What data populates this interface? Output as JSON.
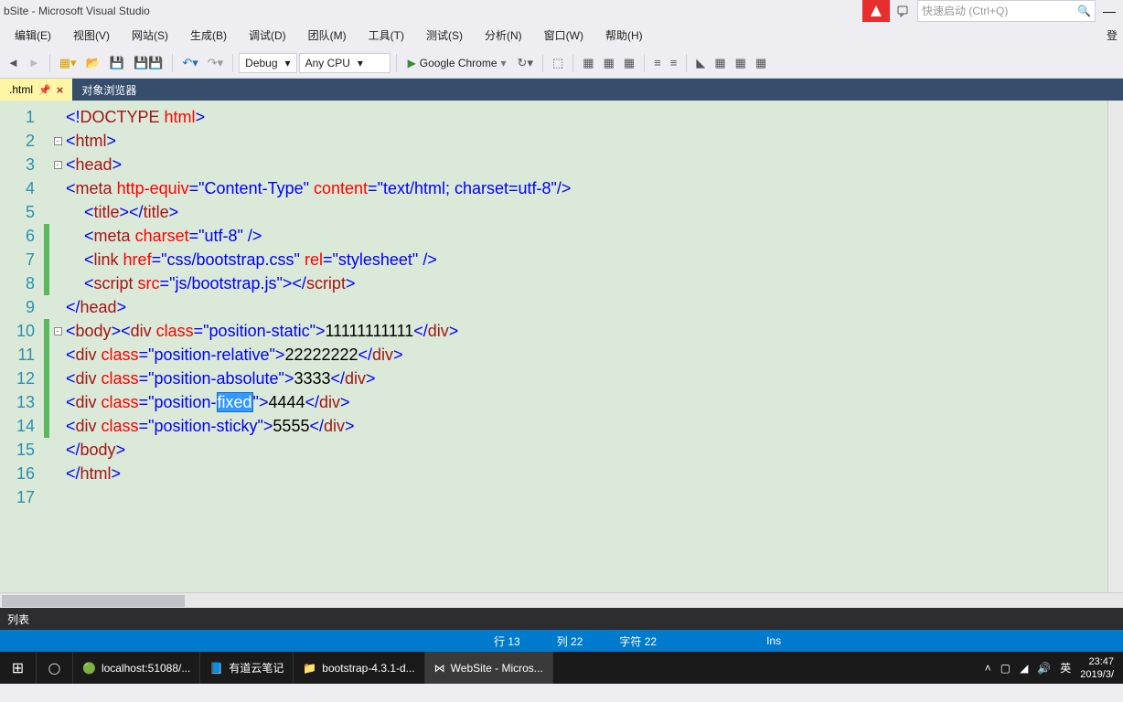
{
  "title": "bSite - Microsoft Visual Studio",
  "search_placeholder": "快速启动 (Ctrl+Q)",
  "right_label": "登",
  "menu": [
    "编辑(E)",
    "视图(V)",
    "网站(S)",
    "生成(B)",
    "调试(D)",
    "团队(M)",
    "工具(T)",
    "测试(S)",
    "分析(N)",
    "窗口(W)",
    "帮助(H)"
  ],
  "toolbar": {
    "config": "Debug",
    "platform": "Any CPU",
    "run_target": "Google Chrome"
  },
  "tabs": [
    {
      "label": ".html",
      "active": true
    },
    {
      "label": "对象浏览器",
      "active": false
    }
  ],
  "code_lines": [
    {
      "n": 1,
      "fold": "",
      "mark": "",
      "tokens": [
        {
          "t": "<!",
          "c": "c-blue"
        },
        {
          "t": "DOCTYPE",
          "c": "c-brown"
        },
        {
          "t": " ",
          "c": "c-text"
        },
        {
          "t": "html",
          "c": "c-red"
        },
        {
          "t": ">",
          "c": "c-blue"
        }
      ]
    },
    {
      "n": 2,
      "fold": "-",
      "mark": "",
      "tokens": [
        {
          "t": "<",
          "c": "c-blue"
        },
        {
          "t": "html",
          "c": "c-brown"
        },
        {
          "t": ">",
          "c": "c-blue"
        }
      ]
    },
    {
      "n": 3,
      "fold": "-",
      "mark": "",
      "tokens": [
        {
          "t": "<",
          "c": "c-blue"
        },
        {
          "t": "head",
          "c": "c-brown"
        },
        {
          "t": ">",
          "c": "c-blue"
        }
      ]
    },
    {
      "n": 4,
      "fold": "",
      "mark": "",
      "tokens": [
        {
          "t": "<",
          "c": "c-blue"
        },
        {
          "t": "meta",
          "c": "c-brown"
        },
        {
          "t": " ",
          "c": ""
        },
        {
          "t": "http-equiv",
          "c": "c-red"
        },
        {
          "t": "=",
          "c": "c-blue"
        },
        {
          "t": "\"Content-Type\"",
          "c": "c-str"
        },
        {
          "t": " ",
          "c": ""
        },
        {
          "t": "content",
          "c": "c-red"
        },
        {
          "t": "=",
          "c": "c-blue"
        },
        {
          "t": "\"text/html; charset=utf-8\"",
          "c": "c-str"
        },
        {
          "t": "/>",
          "c": "c-blue"
        }
      ]
    },
    {
      "n": 5,
      "fold": "",
      "mark": "",
      "tokens": [
        {
          "t": "    <",
          "c": "c-blue"
        },
        {
          "t": "title",
          "c": "c-brown"
        },
        {
          "t": "></",
          "c": "c-blue"
        },
        {
          "t": "title",
          "c": "c-brown"
        },
        {
          "t": ">",
          "c": "c-blue"
        }
      ]
    },
    {
      "n": 6,
      "fold": "",
      "mark": "green",
      "tokens": [
        {
          "t": "    <",
          "c": "c-blue"
        },
        {
          "t": "meta",
          "c": "c-brown"
        },
        {
          "t": " ",
          "c": ""
        },
        {
          "t": "charset",
          "c": "c-red"
        },
        {
          "t": "=",
          "c": "c-blue"
        },
        {
          "t": "\"utf-8\"",
          "c": "c-str"
        },
        {
          "t": " />",
          "c": "c-blue"
        }
      ]
    },
    {
      "n": 7,
      "fold": "",
      "mark": "green",
      "tokens": [
        {
          "t": "    <",
          "c": "c-blue"
        },
        {
          "t": "link",
          "c": "c-brown"
        },
        {
          "t": " ",
          "c": ""
        },
        {
          "t": "href",
          "c": "c-red"
        },
        {
          "t": "=",
          "c": "c-blue"
        },
        {
          "t": "\"css/bootstrap.css\"",
          "c": "c-str"
        },
        {
          "t": " ",
          "c": ""
        },
        {
          "t": "rel",
          "c": "c-red"
        },
        {
          "t": "=",
          "c": "c-blue"
        },
        {
          "t": "\"stylesheet\"",
          "c": "c-str"
        },
        {
          "t": " />",
          "c": "c-blue"
        }
      ]
    },
    {
      "n": 8,
      "fold": "",
      "mark": "green",
      "tokens": [
        {
          "t": "    <",
          "c": "c-blue"
        },
        {
          "t": "script",
          "c": "c-brown"
        },
        {
          "t": " ",
          "c": ""
        },
        {
          "t": "src",
          "c": "c-red"
        },
        {
          "t": "=",
          "c": "c-blue"
        },
        {
          "t": "\"js/bootstrap.js\"",
          "c": "c-str"
        },
        {
          "t": "></",
          "c": "c-blue"
        },
        {
          "t": "script",
          "c": "c-brown"
        },
        {
          "t": ">",
          "c": "c-blue"
        }
      ]
    },
    {
      "n": 9,
      "fold": "",
      "mark": "",
      "tokens": [
        {
          "t": "</",
          "c": "c-blue"
        },
        {
          "t": "head",
          "c": "c-brown"
        },
        {
          "t": ">",
          "c": "c-blue"
        }
      ]
    },
    {
      "n": 10,
      "fold": "-",
      "mark": "green",
      "tokens": [
        {
          "t": "<",
          "c": "c-blue"
        },
        {
          "t": "body",
          "c": "c-brown"
        },
        {
          "t": "><",
          "c": "c-blue"
        },
        {
          "t": "div",
          "c": "c-brown"
        },
        {
          "t": " ",
          "c": ""
        },
        {
          "t": "class",
          "c": "c-red"
        },
        {
          "t": "=",
          "c": "c-blue"
        },
        {
          "t": "\"position-static\"",
          "c": "c-str"
        },
        {
          "t": ">",
          "c": "c-blue"
        },
        {
          "t": "11111111111",
          "c": "c-text"
        },
        {
          "t": "</",
          "c": "c-blue"
        },
        {
          "t": "div",
          "c": "c-brown"
        },
        {
          "t": ">",
          "c": "c-blue"
        }
      ]
    },
    {
      "n": 11,
      "fold": "",
      "mark": "green",
      "tokens": [
        {
          "t": "<",
          "c": "c-blue"
        },
        {
          "t": "div",
          "c": "c-brown"
        },
        {
          "t": " ",
          "c": ""
        },
        {
          "t": "class",
          "c": "c-red"
        },
        {
          "t": "=",
          "c": "c-blue"
        },
        {
          "t": "\"position-relative\"",
          "c": "c-str"
        },
        {
          "t": ">",
          "c": "c-blue"
        },
        {
          "t": "22222222",
          "c": "c-text"
        },
        {
          "t": "</",
          "c": "c-blue"
        },
        {
          "t": "div",
          "c": "c-brown"
        },
        {
          "t": ">",
          "c": "c-blue"
        }
      ]
    },
    {
      "n": 12,
      "fold": "",
      "mark": "green",
      "tokens": [
        {
          "t": "<",
          "c": "c-blue"
        },
        {
          "t": "div",
          "c": "c-brown"
        },
        {
          "t": " ",
          "c": ""
        },
        {
          "t": "class",
          "c": "c-red"
        },
        {
          "t": "=",
          "c": "c-blue"
        },
        {
          "t": "\"position-absolute\"",
          "c": "c-str"
        },
        {
          "t": ">",
          "c": "c-blue"
        },
        {
          "t": "3333",
          "c": "c-text"
        },
        {
          "t": "</",
          "c": "c-blue"
        },
        {
          "t": "div",
          "c": "c-brown"
        },
        {
          "t": ">",
          "c": "c-blue"
        }
      ]
    },
    {
      "n": 13,
      "fold": "",
      "mark": "green",
      "sel": "fixed",
      "tokens": [
        {
          "t": "<",
          "c": "c-blue"
        },
        {
          "t": "div",
          "c": "c-brown"
        },
        {
          "t": " ",
          "c": ""
        },
        {
          "t": "class",
          "c": "c-red"
        },
        {
          "t": "=",
          "c": "c-blue"
        },
        {
          "t": "\"position-",
          "c": "c-str"
        },
        {
          "t": "fixed",
          "c": "sel"
        },
        {
          "t": "\"",
          "c": "c-str"
        },
        {
          "t": ">",
          "c": "c-blue"
        },
        {
          "t": "4444",
          "c": "c-text"
        },
        {
          "t": "</",
          "c": "c-blue"
        },
        {
          "t": "div",
          "c": "c-brown"
        },
        {
          "t": ">",
          "c": "c-blue"
        }
      ]
    },
    {
      "n": 14,
      "fold": "",
      "mark": "green",
      "tokens": [
        {
          "t": "<",
          "c": "c-blue"
        },
        {
          "t": "div",
          "c": "c-brown"
        },
        {
          "t": " ",
          "c": ""
        },
        {
          "t": "class",
          "c": "c-red"
        },
        {
          "t": "=",
          "c": "c-blue"
        },
        {
          "t": "\"position-sticky\"",
          "c": "c-str"
        },
        {
          "t": ">",
          "c": "c-blue"
        },
        {
          "t": "5555",
          "c": "c-text"
        },
        {
          "t": "</",
          "c": "c-blue"
        },
        {
          "t": "div",
          "c": "c-brown"
        },
        {
          "t": ">",
          "c": "c-blue"
        }
      ]
    },
    {
      "n": 15,
      "fold": "",
      "mark": "",
      "tokens": [
        {
          "t": "</",
          "c": "c-blue"
        },
        {
          "t": "body",
          "c": "c-brown"
        },
        {
          "t": ">",
          "c": "c-blue"
        }
      ]
    },
    {
      "n": 16,
      "fold": "",
      "mark": "",
      "tokens": [
        {
          "t": "</",
          "c": "c-blue"
        },
        {
          "t": "html",
          "c": "c-brown"
        },
        {
          "t": ">",
          "c": "c-blue"
        }
      ]
    },
    {
      "n": 17,
      "fold": "",
      "mark": "",
      "tokens": []
    }
  ],
  "bottom_panel_title": "列表",
  "status": {
    "line": "行 13",
    "col": "列 22",
    "char": "字符 22",
    "ins": "Ins"
  },
  "taskbar": {
    "items": [
      {
        "icon": "chrome",
        "label": "localhost:51088/..."
      },
      {
        "icon": "youdao",
        "label": "有道云笔记"
      },
      {
        "icon": "folder",
        "label": "bootstrap-4.3.1-d..."
      },
      {
        "icon": "vs",
        "label": "WebSite - Micros...",
        "active": true
      }
    ],
    "ime": "英",
    "time": "23:47",
    "date": "2019/3/"
  }
}
